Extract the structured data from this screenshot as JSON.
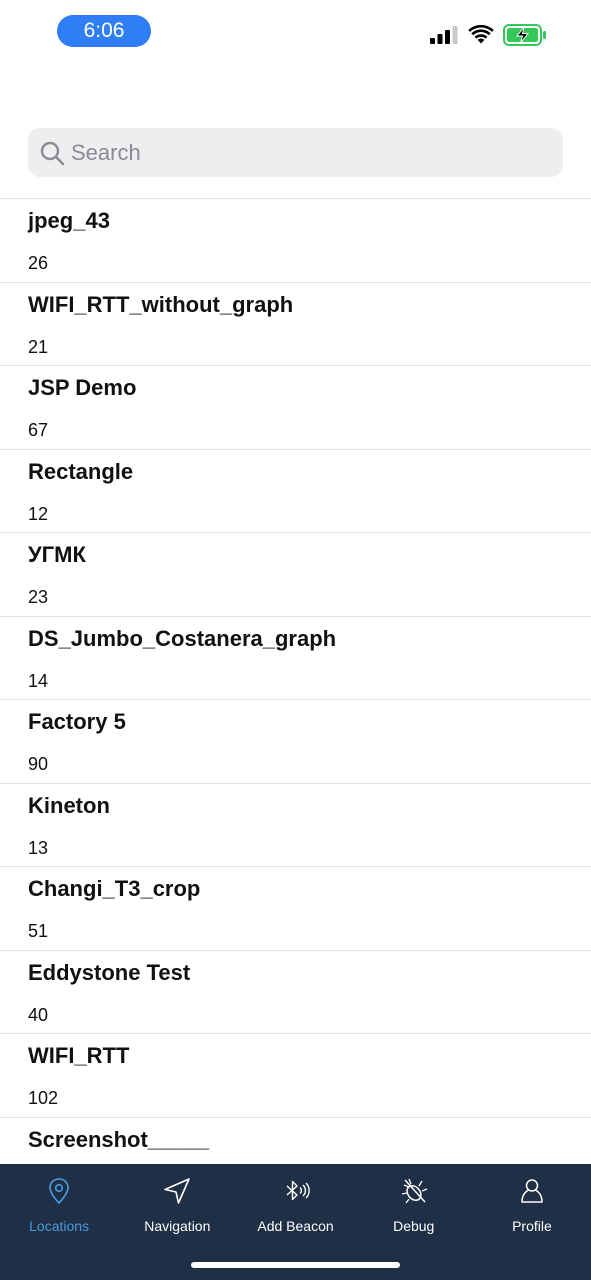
{
  "status_bar": {
    "time": "6:06",
    "icons": [
      "cellular-signal-icon",
      "wifi-icon",
      "battery-charging-icon"
    ],
    "accent_color": "#2f7ef6",
    "battery_color": "#34c759"
  },
  "search": {
    "placeholder": "Search",
    "value": ""
  },
  "locations": [
    {
      "name": "jpeg_43",
      "count": "26"
    },
    {
      "name": "WIFI_RTT_without_graph",
      "count": "21"
    },
    {
      "name": "JSP Demo",
      "count": "67"
    },
    {
      "name": "Rectangle",
      "count": "12"
    },
    {
      "name": "УГМК",
      "count": "23"
    },
    {
      "name": "DS_Jumbo_Costanera_graph",
      "count": "14"
    },
    {
      "name": "Factory 5",
      "count": "90"
    },
    {
      "name": "Kineton",
      "count": "13"
    },
    {
      "name": "Changi_T3_crop",
      "count": "51"
    },
    {
      "name": "Eddystone Test",
      "count": "40"
    },
    {
      "name": "WIFI_RTT",
      "count": "102"
    },
    {
      "name": "Screenshot_____",
      "count": ""
    }
  ],
  "tab_bar": {
    "background": "#1f2f45",
    "active_color": "#4a9be0",
    "tabs": [
      {
        "label": "Locations",
        "icon": "location-pin-icon",
        "active": true
      },
      {
        "label": "Navigation",
        "icon": "navigation-arrow-icon",
        "active": false
      },
      {
        "label": "Add Beacon",
        "icon": "bluetooth-beacon-icon",
        "active": false
      },
      {
        "label": "Debug",
        "icon": "debug-bug-icon",
        "active": false
      },
      {
        "label": "Profile",
        "icon": "person-icon",
        "active": false
      }
    ]
  }
}
